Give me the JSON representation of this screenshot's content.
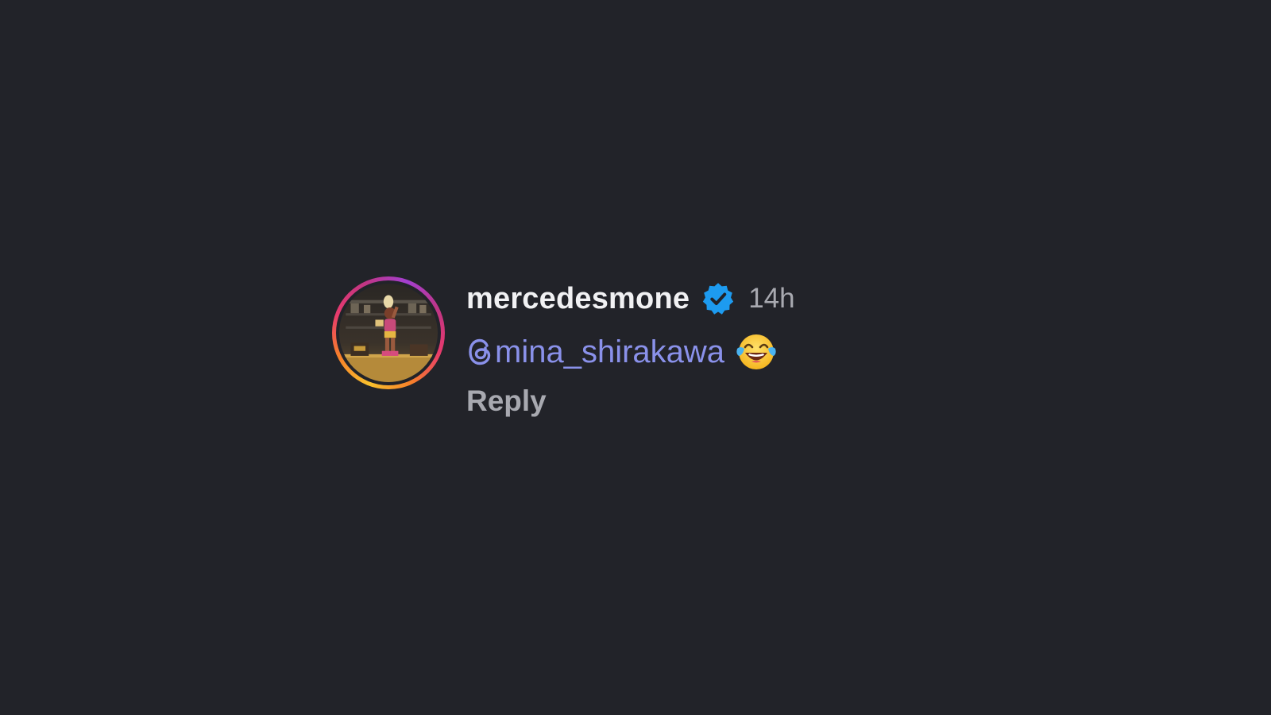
{
  "comment": {
    "username": "mercedesmone",
    "verified_badge": "verified-icon",
    "timestamp": "14h",
    "mention_icon": "threads-icon",
    "mention": "mina_shirakawa",
    "emoji": "face-with-tears-of-joy",
    "reply_label": "Reply"
  },
  "colors": {
    "background": "#222329",
    "username": "#f1f1f3",
    "timestamp": "#a8a9b0",
    "mention": "#8a91ea",
    "verified": "#1d9bf0"
  }
}
